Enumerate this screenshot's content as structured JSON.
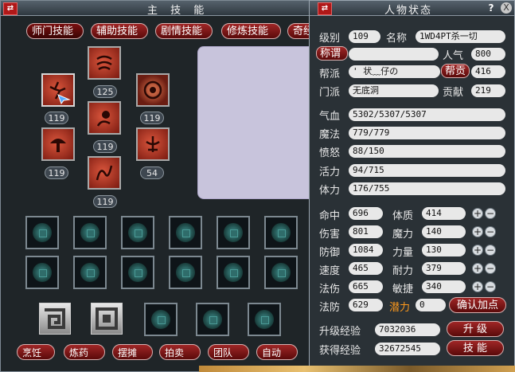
{
  "skill_window": {
    "title": "主 技 能",
    "tabs": [
      "师门技能",
      "辅助技能",
      "剧情技能",
      "修炼技能",
      "奇经"
    ],
    "skill_levels": [
      "125",
      "119",
      "119",
      "119",
      "119",
      "54",
      "119"
    ],
    "bottom_buttons": [
      "烹饪",
      "炼药",
      "摆摊",
      "拍卖",
      "团队",
      "自动"
    ]
  },
  "status_window": {
    "title": "人物状态",
    "help": "?",
    "close": "X",
    "level_label": "级别",
    "level": "109",
    "name_label": "名称",
    "name": "1WD4PT杀一切",
    "title_button": "称谓",
    "title_value": "",
    "popularity_label": "人气",
    "popularity": "800",
    "guild_label": "帮派",
    "guild": "' 状﹏仔の",
    "guild_contrib_button": "帮贡",
    "guild_contrib": "416",
    "school_label": "门派",
    "school": "无底洞",
    "contrib_label": "贡献",
    "contrib": "219",
    "hp_label": "气血",
    "hp": "5302/5307/5307",
    "mp_label": "魔法",
    "mp": "779/779",
    "rage_label": "愤怒",
    "rage": "88/150",
    "vitality_label": "活力",
    "vitality": "94/715",
    "stamina_label": "体力",
    "stamina": "176/755",
    "left_stats": [
      {
        "label": "命中",
        "value": "696"
      },
      {
        "label": "伤害",
        "value": "801"
      },
      {
        "label": "防御",
        "value": "1084"
      },
      {
        "label": "速度",
        "value": "465"
      },
      {
        "label": "法伤",
        "value": "665"
      },
      {
        "label": "法防",
        "value": "629"
      }
    ],
    "attributes": [
      {
        "label": "体质",
        "value": "414"
      },
      {
        "label": "魔力",
        "value": "140"
      },
      {
        "label": "力量",
        "value": "130"
      },
      {
        "label": "耐力",
        "value": "379"
      },
      {
        "label": "敏捷",
        "value": "340"
      }
    ],
    "potential_label": "潜力",
    "potential": "0",
    "confirm_button": "确认加点",
    "upgrade_exp_label": "升级经验",
    "upgrade_exp": "7032036",
    "upgrade_button": "升 级",
    "gained_exp_label": "获得经验",
    "gained_exp": "32672545",
    "skills_button": "技 能",
    "plus": "+",
    "minus": "−"
  }
}
